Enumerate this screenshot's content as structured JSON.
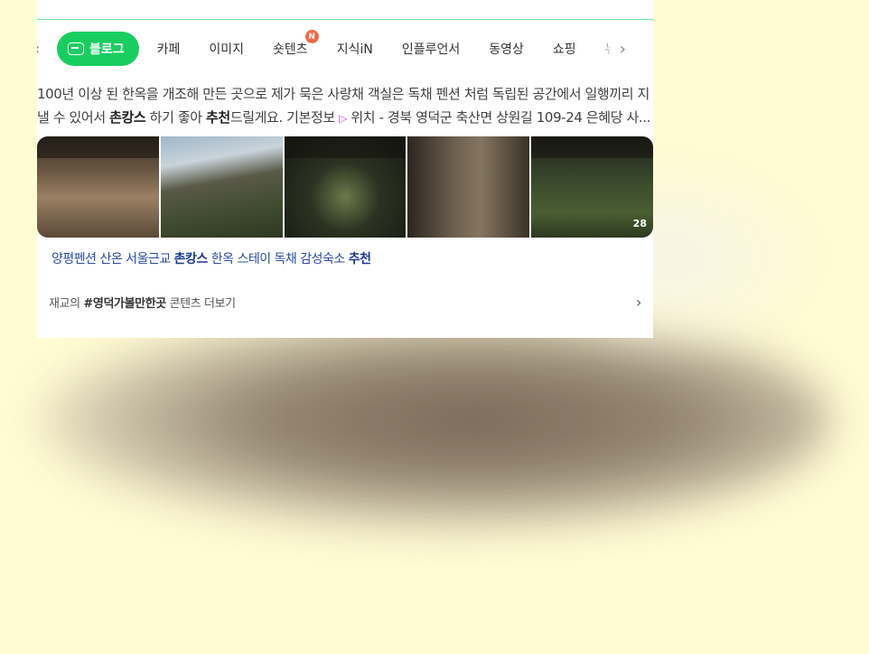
{
  "tabs": {
    "items": [
      {
        "label": "블로그",
        "active": true
      },
      {
        "label": "카페"
      },
      {
        "label": "이미지"
      },
      {
        "label": "숏텐츠",
        "badge": "N"
      },
      {
        "label": "지식iN"
      },
      {
        "label": "인플루언서"
      },
      {
        "label": "동영상"
      },
      {
        "label": "쇼핑"
      },
      {
        "label": "뉴"
      }
    ],
    "prev_icon": "chevron-left-icon",
    "next_icon": "chevron-right-icon",
    "accent": "#19ce60"
  },
  "snippet": {
    "line1": "100년 이상 된 한옥을 개조해 만든 곳으로 제가 묵은 사랑채 객실은 독채 펜션 처럼 독립된 공간에서 일행끼리 지",
    "line2_a": "낼 수 있어서 ",
    "line2_b": "촌캉스",
    "line2_c": " 하기 좋아 ",
    "line2_d": "추천",
    "line2_e": "드릴게요. 기본정보 ",
    "line2_f": "▷",
    "line2_g": " 위치 - 경북 영덕군 축산면 상원길 109-24 은혜당 사..."
  },
  "photos": {
    "count": "28"
  },
  "related": {
    "a": "양평펜션 산온 서울근교 ",
    "b": "촌캉스",
    "c": " 한옥 스테이 독채 감성숙소 ",
    "d": "추천"
  },
  "more": {
    "prefix": "재교의 ",
    "tag": "#영덕가볼만한곳",
    "suffix": " 콘텐츠 더보기"
  }
}
